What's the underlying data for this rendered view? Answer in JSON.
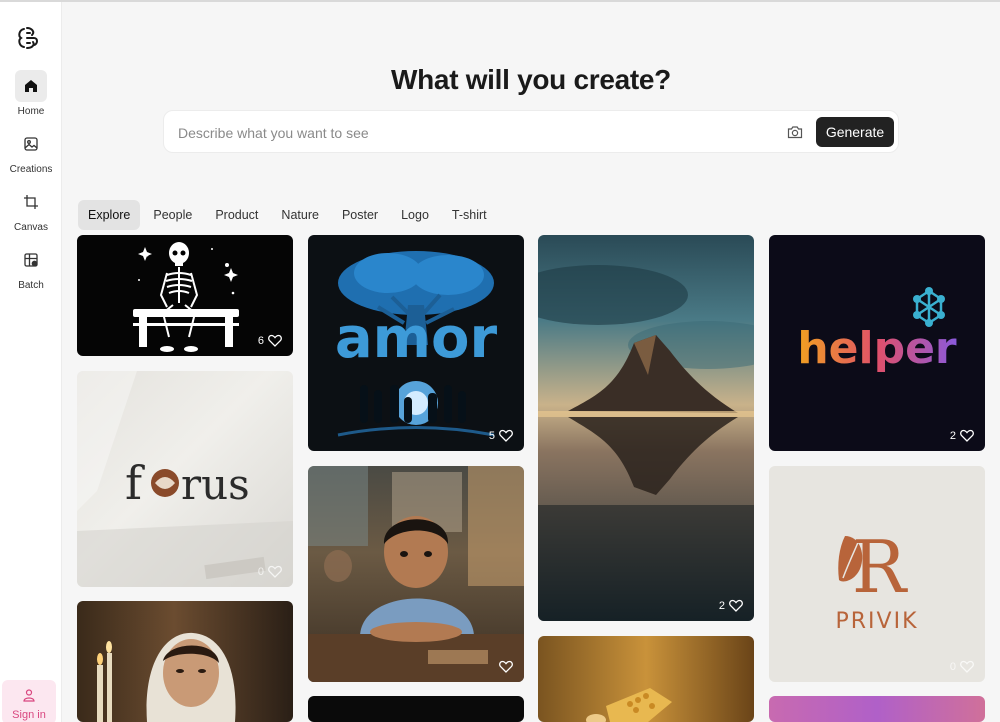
{
  "sidebar": {
    "items": [
      {
        "label": "Home",
        "icon": "home-icon"
      },
      {
        "label": "Creations",
        "icon": "image-icon"
      },
      {
        "label": "Canvas",
        "icon": "crop-icon"
      },
      {
        "label": "Batch",
        "icon": "grid-icon"
      }
    ],
    "signin_label": "Sign in"
  },
  "hero": {
    "title": "What will you create?",
    "placeholder": "Describe what you want to see",
    "generate_label": "Generate"
  },
  "tabs": [
    "Explore",
    "People",
    "Product",
    "Nature",
    "Poster",
    "Logo",
    "T-shirt"
  ],
  "gallery": {
    "skeleton": {
      "likes": "6"
    },
    "forus": {
      "text": "f rus",
      "likes": "0"
    },
    "amor": {
      "text": "amor",
      "likes": "5"
    },
    "boy": {
      "likes": ""
    },
    "mountain": {
      "likes": "2"
    },
    "helper": {
      "text": "helper",
      "likes": "2"
    },
    "privik": {
      "brand": "PRIVIK",
      "mono": "R",
      "likes": "0"
    }
  },
  "colors": {
    "accent": "#222222",
    "signin": "#d9467f"
  }
}
